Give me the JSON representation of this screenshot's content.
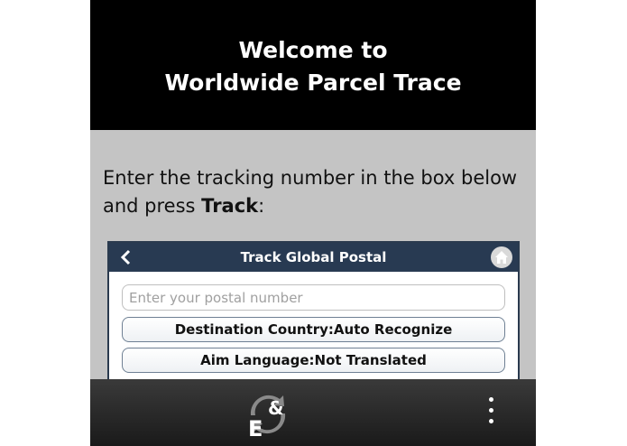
{
  "header": {
    "line1": "Welcome to",
    "line2": "Worldwide Parcel Trace"
  },
  "instruction": {
    "text_before": "Enter the tracking number in the box below and press ",
    "bold": "Track",
    "text_after": ":"
  },
  "app": {
    "back_icon": "<",
    "title": "Track Global Postal",
    "home_icon": "home-icon",
    "input_placeholder": "Enter your postal number",
    "destination_button": "Destination Country:Auto Recognize",
    "language_button": "Aim Language:Not Translated"
  },
  "bottom_bar": {
    "logo_letter": "E",
    "logo_symbol": "&",
    "menu_icon": "overflow-menu-icon"
  },
  "colors": {
    "header_bg": "#000000",
    "page_bg": "#c4c4c4",
    "app_bar_bg": "#283a52",
    "button_border": "#6f8094"
  }
}
